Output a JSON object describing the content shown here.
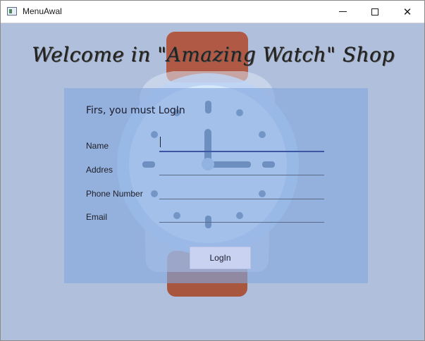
{
  "window": {
    "title": "MenuAwal",
    "minimize_glyph": "",
    "close_glyph": "✕"
  },
  "heading": "Welcome in \"Amazing Watch\" Shop",
  "form": {
    "subtitle": "Firs, you must LogIn",
    "fields": [
      {
        "label": "Name",
        "value": ""
      },
      {
        "label": "Addres",
        "value": ""
      },
      {
        "label": "Phone Number",
        "value": ""
      },
      {
        "label": "Email",
        "value": ""
      }
    ],
    "login_label": "LogIn"
  },
  "icons": {
    "app": "window-app-icon",
    "background": "watch-illustration"
  },
  "colors": {
    "background": "#b0c0dc",
    "panel": "#82a8de",
    "strap": "#b05a45",
    "button": "#c9d2f0"
  }
}
